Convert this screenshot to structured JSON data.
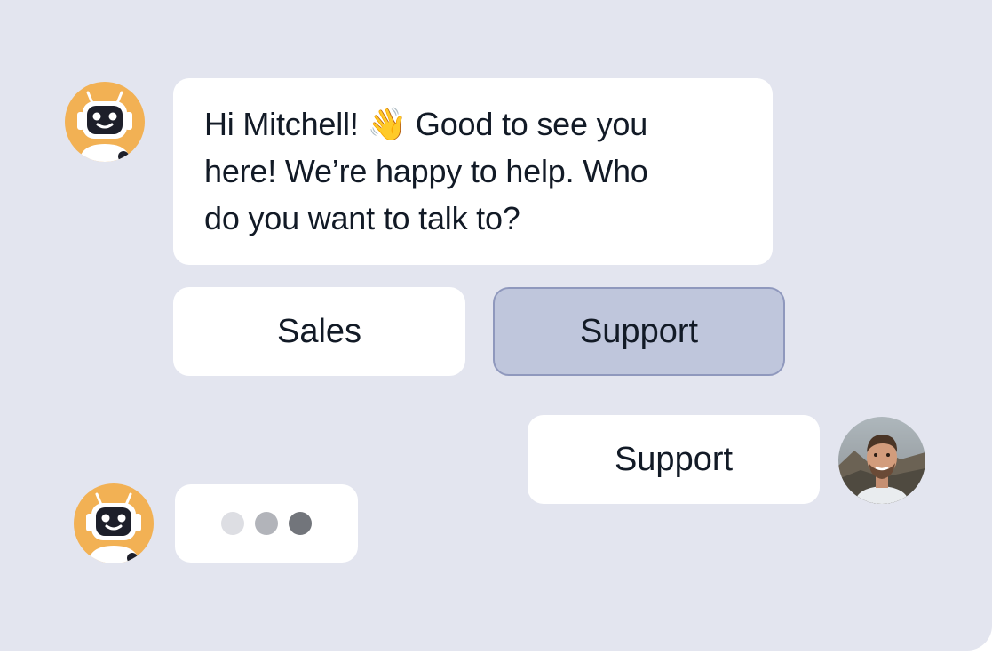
{
  "bot_message": {
    "text_line1": "Hi Mitchell!",
    "emoji": "👋",
    "text_line1_rest": "Good to see you",
    "text_line2": "here! We’re happy to help. Who",
    "text_line3": "do you want to talk to?"
  },
  "options": [
    {
      "label": "Sales",
      "selected": false
    },
    {
      "label": "Support",
      "selected": true
    }
  ],
  "user_reply": {
    "text": "Support"
  },
  "typing_indicator": {
    "dots": 3
  },
  "colors": {
    "background": "#e3e5ef",
    "bubble": "#ffffff",
    "selected_option_bg": "#bfc6dc",
    "selected_option_border": "#8f98bd",
    "bot_avatar": "#f2b154",
    "text": "#121a26"
  },
  "icons": {
    "bot_avatar": "robot-avatar-icon",
    "user_avatar": "user-photo-avatar",
    "wave": "waving-hand-emoji"
  }
}
